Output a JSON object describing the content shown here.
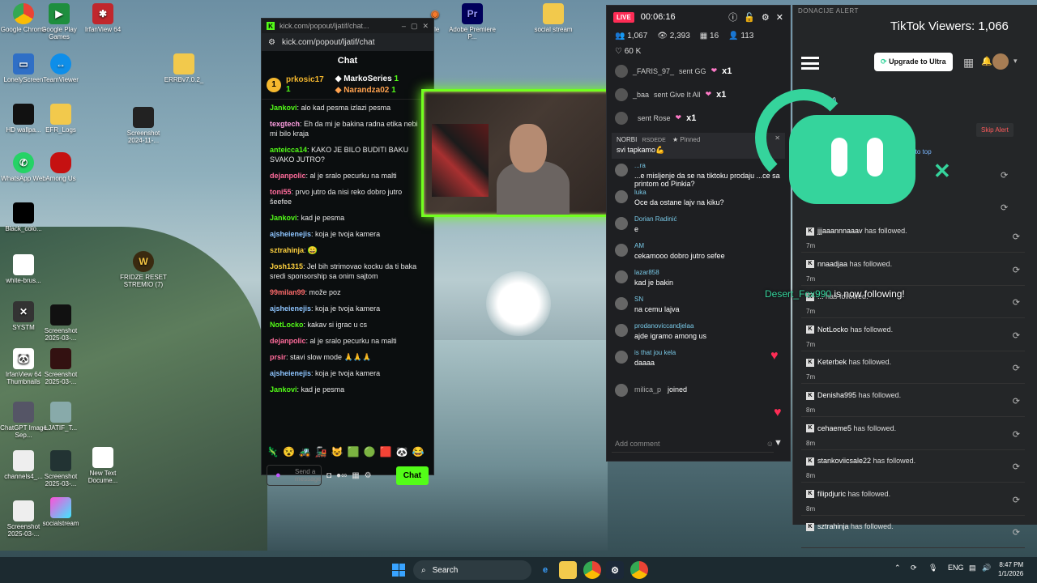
{
  "desktop": {
    "icons": [
      {
        "label": "Google Chrome"
      },
      {
        "label": "Google Play Games"
      },
      {
        "label": "IrfanView 64"
      },
      {
        "label": "LonelyScreen"
      },
      {
        "label": "TeamViewer"
      },
      {
        "label": "ERRBv7.0.2_"
      },
      {
        "label": "HD wallpa..."
      },
      {
        "label": "EFR_Logs"
      },
      {
        "label": "Screenshot 2024-11-..."
      },
      {
        "label": "WhatsApp Web"
      },
      {
        "label": "Among Us"
      },
      {
        "label": "Black_colo..."
      },
      {
        "label": "white-brus..."
      },
      {
        "label": "FRIDZE RESET STREMIO (7)"
      },
      {
        "label": "SYSTM"
      },
      {
        "label": "Screenshot 2025-03-..."
      },
      {
        "label": "IrfanView 64 Thumbnails"
      },
      {
        "label": "Screenshot 2025-03-..."
      },
      {
        "label": "ChatGPT Image Sep..."
      },
      {
        "label": "LJATIF_T..."
      },
      {
        "label": "channels4_..."
      },
      {
        "label": "Screenshot 2025-03-..."
      },
      {
        "label": "New Text Docume..."
      },
      {
        "label": "Screenshot 2025-03-..."
      },
      {
        "label": "socialstream"
      },
      {
        "label": "Adobe Premiere P..."
      },
      {
        "label": "social stream"
      },
      {
        "label": "..le"
      }
    ]
  },
  "kick_chat": {
    "window_title": "kick.com/popout/ljatif/chat...",
    "url": "kick.com/popout/ljatif/chat",
    "header": "Chat",
    "leaderboard": [
      {
        "rank": "1",
        "name": "prkosic17",
        "count": "1"
      },
      {
        "name": "MarkoSeries",
        "count": "1"
      },
      {
        "name": "Narandza02",
        "count": "1"
      }
    ],
    "messages": [
      {
        "user": "Jankovi",
        "color": "#53fc18",
        "text": "alo kad pesma izlazi pesma"
      },
      {
        "user": "texgtech",
        "color": "#ff9ee2",
        "text": "Eh da mi je bakina radna etika nebi mi bilo kraja"
      },
      {
        "user": "anteicca14",
        "color": "#53fc18",
        "text": "KAKO JE BILO BUDITI BAKU SVAKO JUTRO?"
      },
      {
        "user": "dejanpolic",
        "color": "#ff6b9b",
        "text": "al je sralo pecurku na malti"
      },
      {
        "user": "toni55",
        "color": "#ff6b9b",
        "text": "prvo jutro da nisi reko dobro jutro šeefee"
      },
      {
        "user": "Jankovi",
        "color": "#53fc18",
        "text": "kad je pesma"
      },
      {
        "user": "ajsheienejis",
        "color": "#8ec5ff",
        "text": "koja je tvoja kamera"
      },
      {
        "user": "sztrahinja",
        "color": "#ffd23f",
        "text": ""
      },
      {
        "user": "Josh1315",
        "color": "#ffd23f",
        "text": "Jel bih strimovao kocku da ti baka sredi sponsorship sa onim sajtom"
      },
      {
        "user": "99milan99",
        "color": "#ff6b6b",
        "text": "može poz"
      },
      {
        "user": "ajsheienejis",
        "color": "#8ec5ff",
        "text": "koja je tvoja kamera"
      },
      {
        "user": "NotLocko",
        "color": "#53fc18",
        "text": "kakav si igrac u cs"
      },
      {
        "user": "dejanpolic",
        "color": "#ff6b9b",
        "text": "al je sralo pecurku na malti"
      },
      {
        "user": "prsir",
        "color": "#ff6b9b",
        "text": "stavi slow mode 🙏🙏🙏"
      },
      {
        "user": "ajsheienejis",
        "color": "#8ec5ff",
        "text": "koja je tvoja kamera"
      },
      {
        "user": "Jankovi",
        "color": "#53fc18",
        "text": "kad je pesma"
      }
    ],
    "input_placeholder": "Send a message",
    "send_label": "Chat"
  },
  "tiktok_live": {
    "live_label": "LIVE",
    "timer": "00:06:16",
    "stats": {
      "viewers": "1,067",
      "views": "2,393",
      "gifts": "16",
      "followers": "113"
    },
    "likes": "60 K",
    "gifts": [
      {
        "user": "_FARIS_97_",
        "text": "sent GG",
        "mult": "x1"
      },
      {
        "user": "_baa",
        "text": "sent Give It All",
        "mult": "x1"
      },
      {
        "user": "",
        "text": "sent Rose",
        "mult": "x1"
      }
    ],
    "pinned": {
      "user": "NORBI",
      "tag": "RSDEDE",
      "label": "Pinned",
      "time": "24s",
      "text": "svi tapkamo💪"
    },
    "comments": [
      {
        "user": "...ra",
        "text": "...e misljenje da se na tiktoku prodaju ...ce sa printom od Pinkia?"
      },
      {
        "user": "luka",
        "text": "Oce da ostane lajv na kiku?"
      },
      {
        "user": "Dorian Radinić",
        "text": "e"
      },
      {
        "user": "AM",
        "text": "cekamooo dobro jutro sefee"
      },
      {
        "user": "lazar858",
        "text": "kad je bakin"
      },
      {
        "user": "SN",
        "text": "na cemu lajva"
      },
      {
        "user": "prodanoviccandjelaa",
        "text": "ajde igramo among us"
      },
      {
        "user": "is that jou kela",
        "text": "daaaa"
      }
    ],
    "joined": {
      "user": "milica_p",
      "text": "joined"
    },
    "comment_placeholder": "Add comment"
  },
  "alerts": {
    "panel_title": "DONACIJE ALERT",
    "tiktok_viewers": "TikTok Viewers: 1,066",
    "upgrade_label": "Upgrade to Ultra",
    "skip_label": "Skip Alert",
    "back_to_top": "...to top",
    "follows": [
      {
        "user": "jjjaaannnaaav",
        "text": "has followed.",
        "time": "7m"
      },
      {
        "user": "nnaadjaa",
        "text": "has followed.",
        "time": "7m"
      },
      {
        "user": "...",
        "text": "has followed.",
        "time": "7m"
      },
      {
        "user": "NotLocko",
        "text": "has followed.",
        "time": "7m"
      },
      {
        "user": "Keterbek",
        "text": "has followed.",
        "time": "7m"
      },
      {
        "user": "Denisha995",
        "text": "has followed.",
        "time": "8m"
      },
      {
        "user": "cehaeme5",
        "text": "has followed.",
        "time": "8m"
      },
      {
        "user": "stankoviicsale22",
        "text": "has followed.",
        "time": "8m"
      },
      {
        "user": "filipdjuric",
        "text": "has followed.",
        "time": "8m"
      },
      {
        "user": "sztrahinja",
        "text": "has followed.",
        "time": ""
      }
    ],
    "follow_banner": {
      "name": "Desert_Fox990",
      "text": "is now following!"
    }
  },
  "taskbar": {
    "search_label": "Search",
    "lang": "ENG",
    "time": "8:47 PM",
    "date": "1/1/2026"
  }
}
